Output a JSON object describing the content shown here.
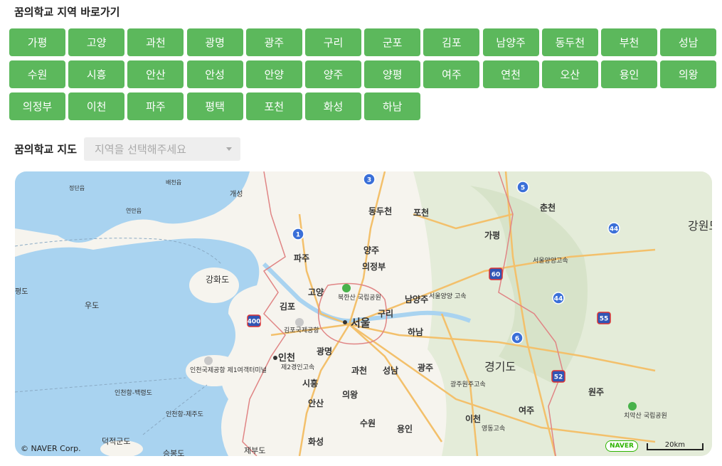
{
  "regions_section": {
    "title": "꿈의학교 지역 바로가기",
    "buttons": [
      "가평",
      "고양",
      "과천",
      "광명",
      "광주",
      "구리",
      "군포",
      "김포",
      "남양주",
      "동두천",
      "부천",
      "성남",
      "수원",
      "시흥",
      "안산",
      "안성",
      "안양",
      "양주",
      "양평",
      "여주",
      "연천",
      "오산",
      "용인",
      "의왕",
      "의정부",
      "이천",
      "파주",
      "평택",
      "포천",
      "화성",
      "하남"
    ]
  },
  "map_section": {
    "title": "꿈의학교 지도",
    "select_placeholder": "지역을 선택해주세요"
  },
  "map": {
    "copyright": "© NAVER Corp.",
    "brand": "NAVER",
    "scale_label": "20km",
    "labels": [
      "동두천",
      "포천",
      "춘천",
      "가평",
      "파주",
      "양주",
      "의정부",
      "강원도",
      "강화도",
      "고양",
      "김포",
      "서울",
      "구리",
      "남양주",
      "하남",
      "인천",
      "광명",
      "과천",
      "성남",
      "광주",
      "경기도",
      "시흥",
      "의왕",
      "안산",
      "수원",
      "용인",
      "이천",
      "여주",
      "원주",
      "화성",
      "우도",
      "덕적군도",
      "승봉도",
      "제부도",
      "개성",
      "연안읍",
      "배천읍",
      "정단읍",
      "평도",
      "북한산 국립공원",
      "치악산 국립공원",
      "김포국제공항",
      "인천국제공항 제1여객터미널",
      "인천항-백령도",
      "인천항-제주도",
      "제2경인고속",
      "서울양양고속",
      "광주원주고속",
      "영동고속",
      "서울양양 고속"
    ],
    "route_shields": [
      "3",
      "5",
      "1",
      "44",
      "60",
      "44",
      "400",
      "55",
      "6",
      "52"
    ],
    "colors": {
      "water": "#a9d3f0",
      "land": "#f6f4ee",
      "forest": "#dfe8d5",
      "road": "#f3c06b",
      "border": "#e08585",
      "park": "#48b24b"
    }
  },
  "colors": {
    "button_bg": "#5cb85c",
    "button_text": "#ffffff",
    "select_bg": "#eeeeee"
  }
}
